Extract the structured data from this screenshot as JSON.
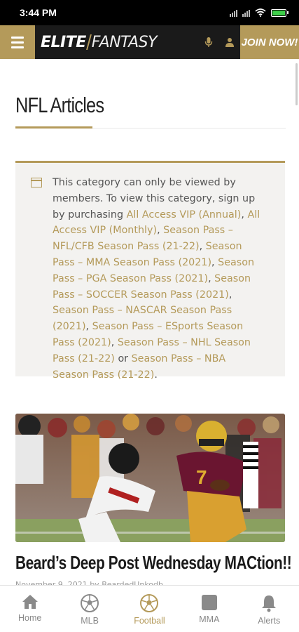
{
  "status_bar": {
    "time": "3:44 PM"
  },
  "header": {
    "logo_part1": "ELITE",
    "logo_part2": "FANTASY",
    "join_label": "JOIN NOW!"
  },
  "page": {
    "title": "NFL Articles"
  },
  "notice": {
    "intro": "This category can only be viewed by members. To view this category, sign up by purchasing ",
    "links": [
      "All Access VIP (Annual)",
      "All Access VIP (Monthly)",
      "Season Pass – NFL/CFB Season Pass (21-22)",
      "Season Pass – MMA Season Pass (2021)",
      "Season Pass – PGA Season Pass (2021)",
      "Season Pass – SOCCER Season Pass (2021)",
      "Season Pass – NASCAR Season Pass (2021)",
      "Season Pass – ESports Season Pass (2021)",
      "Season Pass – NHL Season Pass (21-22)",
      "Season Pass – NBA Season Pass (21-22)"
    ],
    "or_word": "or"
  },
  "article": {
    "title": "Beard’s Deep Post Wednesday MACtion!!",
    "meta": "November 9, 2021 by BeardedUnkodb..."
  },
  "bottom_nav": [
    {
      "label": "Home",
      "icon": "home-icon",
      "active": false
    },
    {
      "label": "MLB",
      "icon": "soccer-ball-icon",
      "active": false
    },
    {
      "label": "Football",
      "icon": "soccer-ball-icon",
      "active": true
    },
    {
      "label": "MMA",
      "icon": "square-icon",
      "active": false
    },
    {
      "label": "Alerts",
      "icon": "bell-icon",
      "active": false
    }
  ],
  "colors": {
    "accent": "#b49a5a",
    "header_bg": "#1a1a1a",
    "notice_bg": "#f3f2f0"
  }
}
